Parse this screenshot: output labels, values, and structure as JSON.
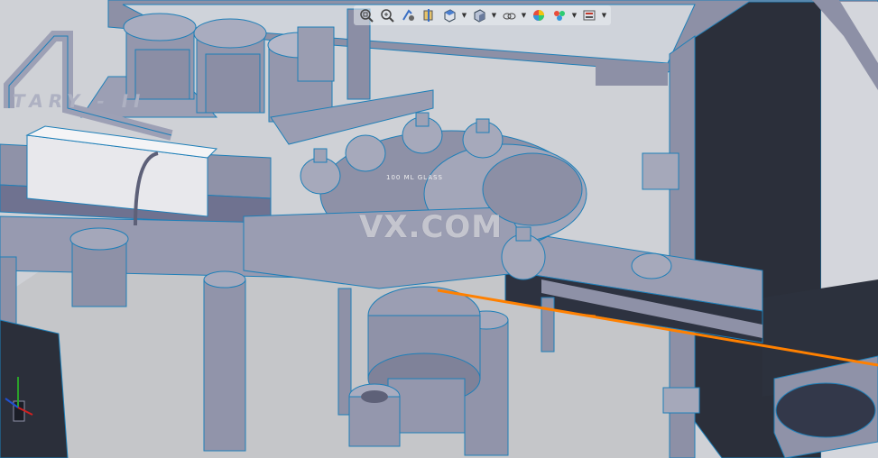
{
  "viewport": {
    "name": "3D CAD model viewport",
    "background_color": "#c9cbd0",
    "model_color": "#8f92a8",
    "edge_color": "#1e7fb8",
    "highlight_color": "#ff8000"
  },
  "heads_up_toolbar": {
    "buttons": [
      {
        "id": "zoom-to-fit",
        "icon": "zoom-fit-icon"
      },
      {
        "id": "zoom-to-area",
        "icon": "zoom-area-icon"
      },
      {
        "id": "previous-view",
        "icon": "previous-view-icon"
      },
      {
        "id": "section-view",
        "icon": "section-view-icon"
      },
      {
        "id": "view-orientation",
        "icon": "view-orientation-icon"
      },
      {
        "id": "display-style",
        "icon": "display-style-icon"
      },
      {
        "id": "hide-show-items",
        "icon": "hide-show-icon"
      },
      {
        "id": "edit-appearance",
        "icon": "appearance-icon"
      },
      {
        "id": "apply-scene",
        "icon": "scene-icon"
      },
      {
        "id": "view-settings",
        "icon": "view-settings-icon"
      }
    ]
  },
  "model_text": {
    "engraved_label": "TARY - II",
    "plate_label": "100 ML GLASS"
  },
  "watermark": {
    "text": "VX.COM"
  }
}
